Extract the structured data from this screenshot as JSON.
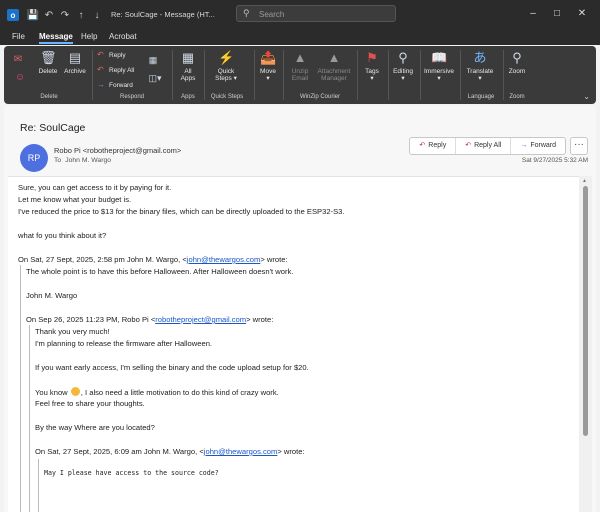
{
  "window": {
    "title": "Re: SoulCage - Message (HT...",
    "search_placeholder": "Search"
  },
  "menu_tabs": [
    "File",
    "Message",
    "Help",
    "Acrobat"
  ],
  "ribbon": {
    "delete_group": {
      "label": "Delete",
      "delete": "Delete",
      "archive": "Archive"
    },
    "respond_group": {
      "label": "Respond",
      "reply": "Reply",
      "reply_all": "Reply All",
      "forward": "Forward"
    },
    "apps_group": {
      "label": "Apps",
      "all_apps_1": "All",
      "all_apps_2": "Apps"
    },
    "quick_steps_group": {
      "label": "Quick Steps",
      "button_1": "Quick",
      "button_2": "Steps"
    },
    "move": "Move",
    "winzip_group": {
      "label": "WinZip Courier",
      "unzip_1": "Unzip",
      "unzip_2": "Email",
      "attach_1": "Attachment",
      "attach_2": "Manager"
    },
    "tags": "Tags",
    "editing": "Editing",
    "immersive": "Immersive",
    "language_group": {
      "label": "Language",
      "translate": "Translate"
    },
    "zoom_group": {
      "label": "Zoom",
      "zoom": "Zoom"
    }
  },
  "message": {
    "subject": "Re: SoulCage",
    "avatar_initials": "RP",
    "from": "Robo Pi <robotheproject@gmail.com>",
    "to_label": "To",
    "to": "John M. Wargo",
    "date": "Sat 9/27/2025 5:32 AM",
    "actions": {
      "reply": "Reply",
      "reply_all": "Reply All",
      "forward": "Forward",
      "more": "···"
    }
  },
  "body": {
    "l1": "Sure, you can get access to it by paying for it.",
    "l2": "Let me know what your budget is.",
    "l3": "I've reduced the price to $13 for the binary files, which can be directly uploaded to the ESP32-S3.",
    "l4": "what fo you think about it?",
    "q1_head_pre": "On Sat, 27 Sept, 2025, 2:58 pm John M. Wargo, <",
    "q1_email": "john@thewargos.com",
    "q1_head_post": "> wrote:",
    "q1_l1": "The whole point is to have this before Halloween. After Halloween doesn't work.",
    "q1_sig": "John M. Wargo",
    "q2_head_pre": "On Sep 26, 2025 11:23 PM, Robo Pi <",
    "q2_email": "robotheproject@gmail.com",
    "q2_head_post": "> wrote:",
    "q2_l1": "Thank you very much!",
    "q2_l2": "I'm planning to release the firmware after Halloween.",
    "q2_l3": "If you want early access, I'm selling the binary and the code upload setup for $20.",
    "q2_l4_pre": "You know",
    "q2_l4_post": ", I also need a little motivation to do this kind of crazy work.",
    "q2_l5": "Feel free to share your thoughts.",
    "q2_l6": "By the way Where are you located?",
    "q3_head_pre": "On Sat, 27 Sept, 2025, 6:09 am John M. Wargo, <",
    "q3_email": "john@thewargos.com",
    "q3_head_post": "> wrote:",
    "q3_l1": "May I please have access to the source code?"
  }
}
